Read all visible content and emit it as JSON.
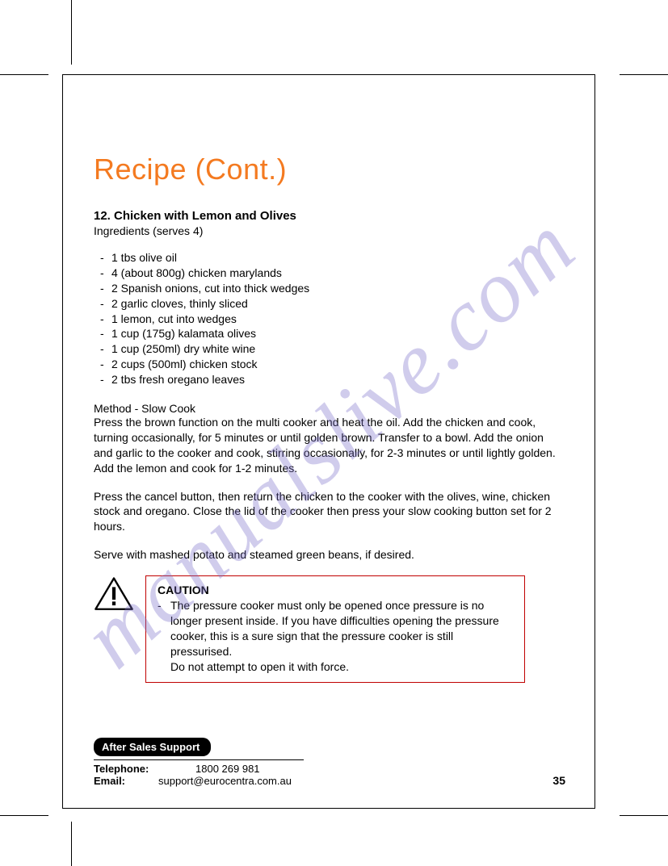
{
  "watermark": "manualslive.com",
  "title": "Recipe (Cont.)",
  "recipe_number_title": "12. Chicken with Lemon and Olives",
  "serves": "Ingredients (serves 4)",
  "ingredients": [
    "1 tbs olive oil",
    "4 (about 800g) chicken marylands",
    "2 Spanish onions, cut into thick wedges",
    "2 garlic cloves, thinly sliced",
    "1 lemon, cut into wedges",
    "1 cup (175g) kalamata olives",
    "1 cup (250ml) dry white wine",
    "2 cups (500ml) chicken stock",
    "2 tbs fresh oregano leaves"
  ],
  "method_head": "Method - Slow Cook",
  "method_p1": "Press the brown function on the multi cooker and heat the oil. Add the chicken and cook, turning occasionally, for 5 minutes or until golden brown. Transfer to a bowl. Add the onion and garlic to the cooker and cook, stirring occasionally, for 2-3 minutes or until lightly golden. Add the lemon and cook for 1-2 minutes.",
  "method_p2": "Press the cancel button, then return the chicken to the cooker with the olives, wine, chicken stock and oregano. Close the lid of the cooker then press your slow cooking button set for 2 hours.",
  "method_p3": "Serve with mashed potato and steamed green beans, if desired.",
  "caution_label": "CAUTION",
  "caution_text": "The pressure cooker must only be opened once pressure is no longer present inside. If you have difficulties opening the pressure cooker, this is a sure sign that the pressure cooker is still pressurised.\nDo not attempt to open it with force.",
  "footer": {
    "pill": "After Sales Support",
    "tel_label": "Telephone:",
    "tel_value": "1800 269 981",
    "email_label": "Email:",
    "email_value": "support@eurocentra.com.au",
    "page_number": "35"
  }
}
